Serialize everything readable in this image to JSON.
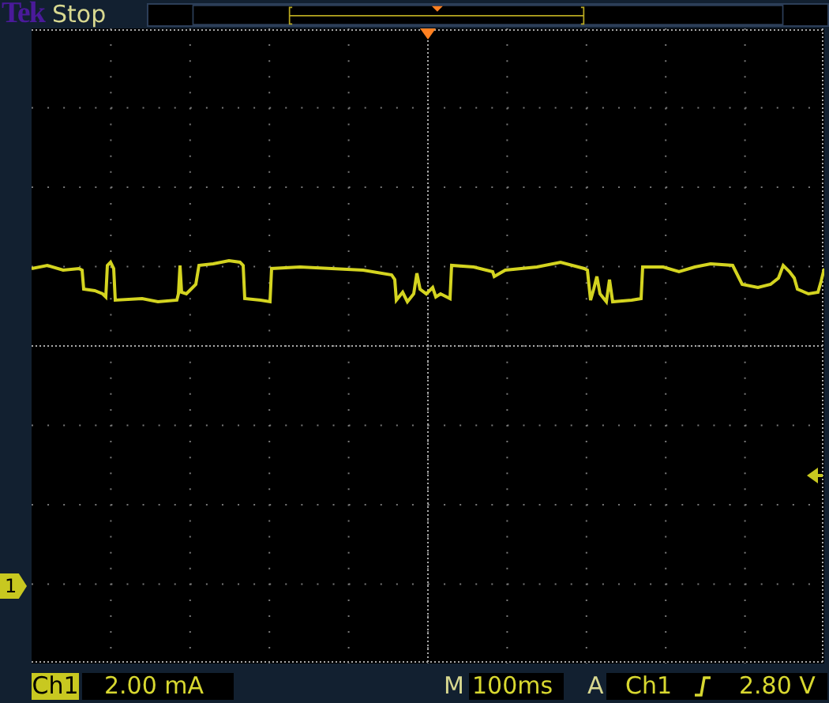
{
  "header": {
    "brand": "Tek",
    "status": "Stop"
  },
  "graticule": {
    "channel_marker": "1"
  },
  "footer": {
    "channel": "Ch1",
    "scale": "2.00 mA",
    "timebase_prefix": "M",
    "timebase": "100ms",
    "trigger_prefix": "A",
    "trigger_source": "Ch1",
    "trigger_level": "2.80 V"
  }
}
